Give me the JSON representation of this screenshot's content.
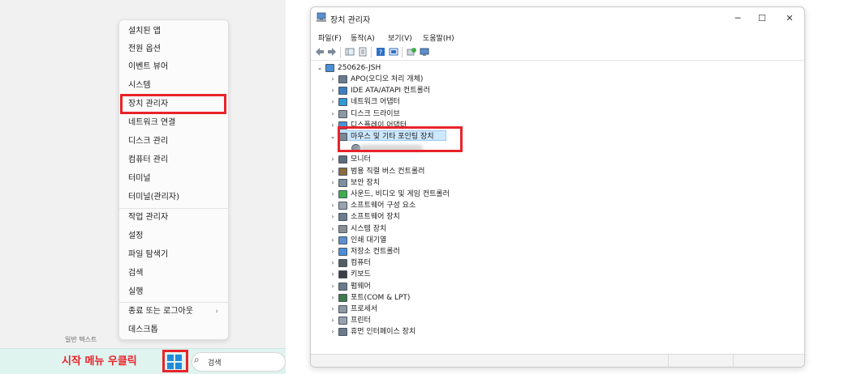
{
  "start_menu": {
    "items": [
      {
        "label": "설치된 앱"
      },
      {
        "label": "전원 옵션"
      },
      {
        "label": "이벤트 뷰어"
      },
      {
        "label": "시스템"
      },
      {
        "label": "장치 관리자"
      },
      {
        "label": "네트워크 연결"
      },
      {
        "label": "디스크 관리"
      },
      {
        "label": "컴퓨터 관리"
      },
      {
        "label": "터미널"
      },
      {
        "label": "터미널(관리자)"
      },
      {
        "label": "작업 관리자"
      },
      {
        "label": "설정"
      },
      {
        "label": "파일 탐색기"
      },
      {
        "label": "검색"
      },
      {
        "label": "실행"
      },
      {
        "label": "종료 또는 로그아웃"
      },
      {
        "label": "데스크톱"
      }
    ],
    "highlighted_item": "장치 관리자"
  },
  "taskbar": {
    "label_above": "일반 텍스트",
    "hint": "시작 메뉴 우클릭",
    "search_placeholder": "검색"
  },
  "device_manager": {
    "title": "장치 관리자",
    "window_controls": {
      "minimize": "─",
      "maximize": "☐",
      "close": "✕"
    },
    "menu": [
      "파일(F)",
      "동작(A)",
      "보기(V)",
      "도움말(H)"
    ],
    "root": "250626-JSH",
    "categories": [
      {
        "label": "APO(오디오 처리 개체)",
        "icon": "speaker-icon"
      },
      {
        "label": "IDE ATA/ATAPI 컨트롤러",
        "icon": "ide-controller-icon"
      },
      {
        "label": "네트워크 어댑터",
        "icon": "network-adapter-icon"
      },
      {
        "label": "디스크 드라이브",
        "icon": "disk-drive-icon"
      },
      {
        "label": "디스플레이 어댑터",
        "icon": "display-adapter-icon"
      },
      {
        "label": "마우스 및 기타 포인팅 장치",
        "icon": "mouse-icon",
        "expanded": true
      },
      {
        "label": "모니터",
        "icon": "monitor-icon"
      },
      {
        "label": "범용 직렬 버스 컨트롤러",
        "icon": "usb-icon"
      },
      {
        "label": "보안 장치",
        "icon": "security-device-icon"
      },
      {
        "label": "사운드, 비디오 및 게임 컨트롤러",
        "icon": "sound-icon"
      },
      {
        "label": "소프트웨어 구성 요소",
        "icon": "software-component-icon"
      },
      {
        "label": "소프트웨어 장치",
        "icon": "software-device-icon"
      },
      {
        "label": "시스템 장치",
        "icon": "system-device-icon"
      },
      {
        "label": "인쇄 대기열",
        "icon": "print-queue-icon"
      },
      {
        "label": "저장소 컨트롤러",
        "icon": "storage-controller-icon"
      },
      {
        "label": "컴퓨터",
        "icon": "computer-icon"
      },
      {
        "label": "키보드",
        "icon": "keyboard-icon"
      },
      {
        "label": "펌웨어",
        "icon": "firmware-icon"
      },
      {
        "label": "포트(COM & LPT)",
        "icon": "port-icon"
      },
      {
        "label": "프로세서",
        "icon": "processor-icon"
      },
      {
        "label": "프린터",
        "icon": "printer-icon"
      },
      {
        "label": "휴먼 인터페이스 장치",
        "icon": "hid-icon"
      }
    ]
  },
  "colors": {
    "highlight": "#e8232a",
    "selection": "#cde8ff",
    "taskbar": "#dff3ef",
    "windows_blue": "#1f8bdc"
  }
}
